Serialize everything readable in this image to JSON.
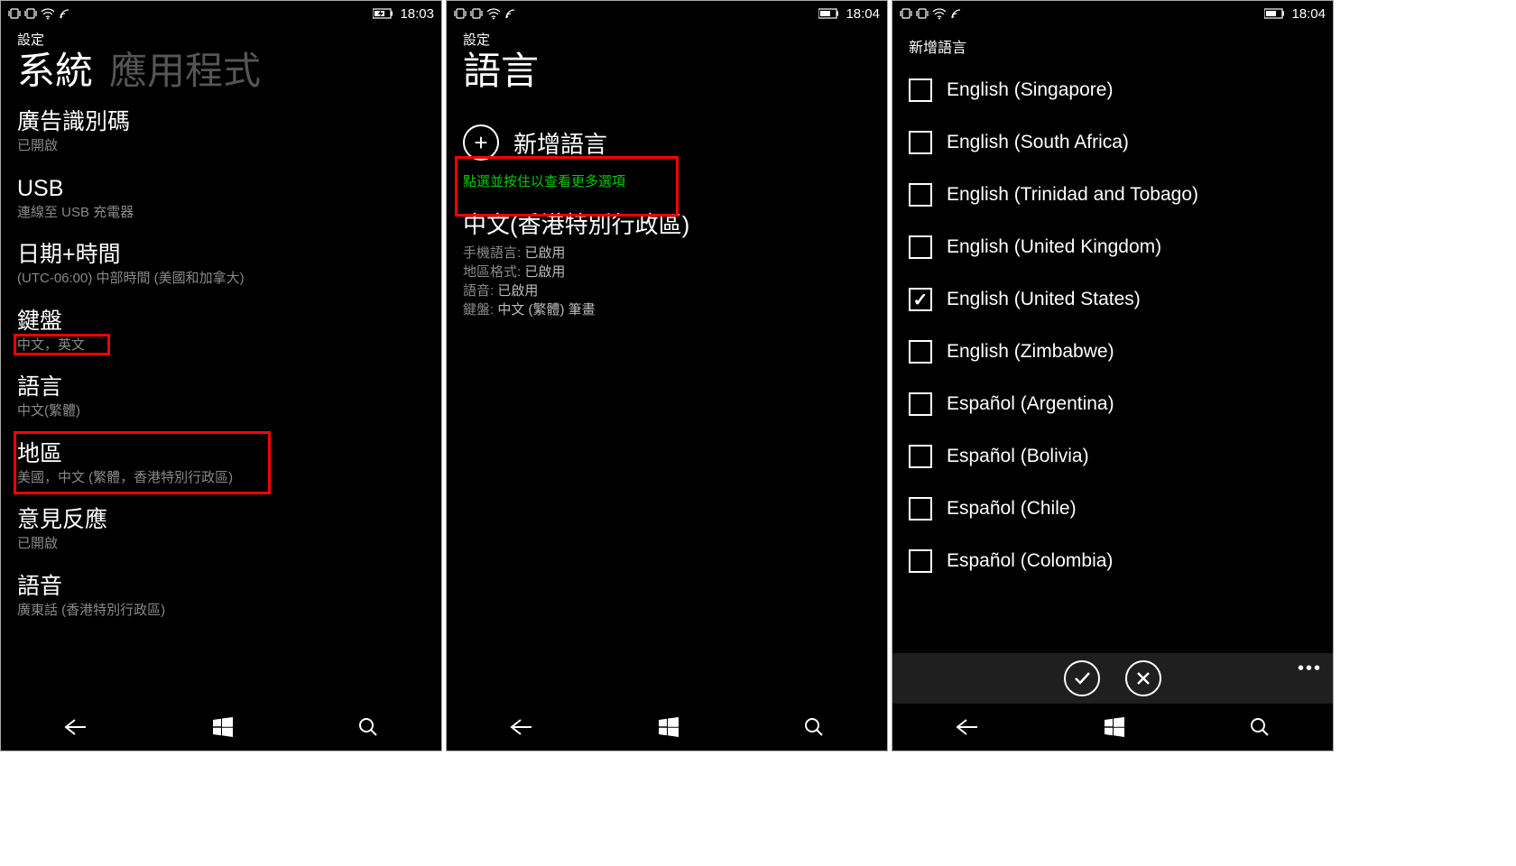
{
  "screens": [
    {
      "status": {
        "time": "18:03"
      },
      "breadcrumb": "設定",
      "pivot": {
        "active": "系統",
        "inactive": "應用程式"
      },
      "items": [
        {
          "title": "廣告識別碼",
          "sub": "已開啟"
        },
        {
          "title": "USB",
          "sub": "連線至 USB 充電器"
        },
        {
          "title": "日期+時間",
          "sub": "(UTC-06:00) 中部時間 (美國和加拿大)"
        },
        {
          "title": "鍵盤",
          "sub": "中文，英文"
        },
        {
          "title": "語言",
          "sub": "中文(繁體)"
        },
        {
          "title": "地區",
          "sub": "美國，中文 (繁體，香港特別行政區)"
        },
        {
          "title": "意見反應",
          "sub": "已開啟"
        },
        {
          "title": "語音",
          "sub": "廣東話 (香港特別行政區)"
        }
      ]
    },
    {
      "status": {
        "time": "18:04"
      },
      "breadcrumb": "設定",
      "title": "語言",
      "add_label": "新增語言",
      "hint": "點選並按住以查看更多選項",
      "lang_block": {
        "title": "中文(香港特別行政區)",
        "rows": [
          {
            "label": "手機語言:",
            "value": "已啟用"
          },
          {
            "label": "地區格式:",
            "value": "已啟用"
          },
          {
            "label": "語音:",
            "value": "已啟用"
          },
          {
            "label": "鍵盤:",
            "value": "中文 (繁體) 筆畫"
          }
        ]
      }
    },
    {
      "status": {
        "time": "18:04"
      },
      "title": "新增語言",
      "languages": [
        {
          "name": "English (Singapore)",
          "checked": false
        },
        {
          "name": "English (South Africa)",
          "checked": false
        },
        {
          "name": "English (Trinidad and Tobago)",
          "checked": false
        },
        {
          "name": "English (United Kingdom)",
          "checked": false
        },
        {
          "name": "English (United States)",
          "checked": true
        },
        {
          "name": "English (Zimbabwe)",
          "checked": false
        },
        {
          "name": "Español (Argentina)",
          "checked": false
        },
        {
          "name": "Español (Bolivia)",
          "checked": false
        },
        {
          "name": "Español (Chile)",
          "checked": false
        },
        {
          "name": "Español (Colombia)",
          "checked": false
        }
      ]
    }
  ]
}
